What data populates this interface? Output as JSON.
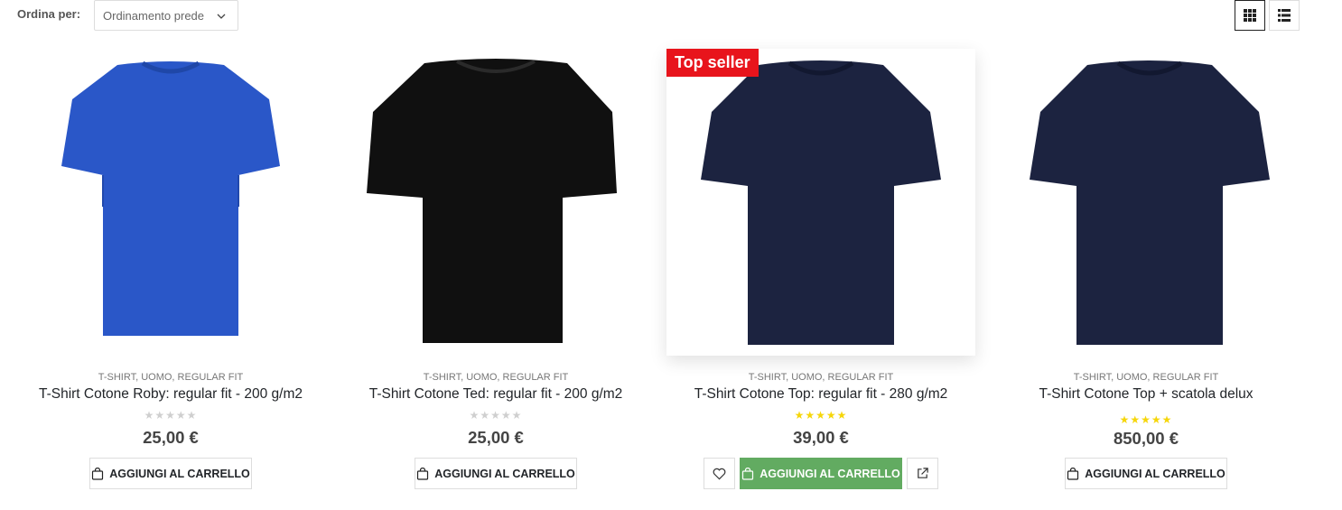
{
  "toolbar": {
    "sort_label": "Ordina per:",
    "sort_value": "Ordinamento predefinito",
    "sort_value_visible": "Ordinamento prede",
    "view_modes": [
      "grid",
      "list"
    ],
    "active_view": "grid"
  },
  "colors": {
    "accent_green": "#62ab61",
    "badge_red": "#e8141c",
    "star_yellow": "#f6d60a",
    "shirt_blue": "#2a57c8",
    "shirt_black": "#101010",
    "shirt_navy": "#1c2340"
  },
  "products": [
    {
      "categories": "T-SHIRT, UOMO, REGULAR FIT",
      "title": "T-Shirt Cotone Roby: regular fit - 200 g/m2",
      "rating": 0,
      "stars": "★★★★★",
      "price": "25,00 €",
      "cart_label": "AGGIUNGI AL CARRELLO",
      "badge": "",
      "shirt_color": "blue"
    },
    {
      "categories": "T-SHIRT, UOMO, REGULAR FIT",
      "title": "T-Shirt Cotone Ted: regular fit - 200 g/m2",
      "rating": 0,
      "stars": "★★★★★",
      "price": "25,00 €",
      "cart_label": "AGGIUNGI AL CARRELLO",
      "badge": "",
      "shirt_color": "black"
    },
    {
      "categories": "T-SHIRT, UOMO, REGULAR FIT",
      "title": "T-Shirt Cotone Top: regular fit - 280 g/m2",
      "rating": 5,
      "stars": "★★★★★",
      "price": "39,00 €",
      "cart_label": "AGGIUNGI AL CARRELLO",
      "badge": "Top seller",
      "shirt_color": "navy"
    },
    {
      "categories": "T-SHIRT, UOMO, REGULAR FIT",
      "title": "T-Shirt Cotone Top + scatola delux",
      "rating": 5,
      "stars": "★★★★★",
      "price": "850,00 €",
      "cart_label": "AGGIUNGI AL CARRELLO",
      "badge": "",
      "shirt_color": "navy"
    }
  ]
}
